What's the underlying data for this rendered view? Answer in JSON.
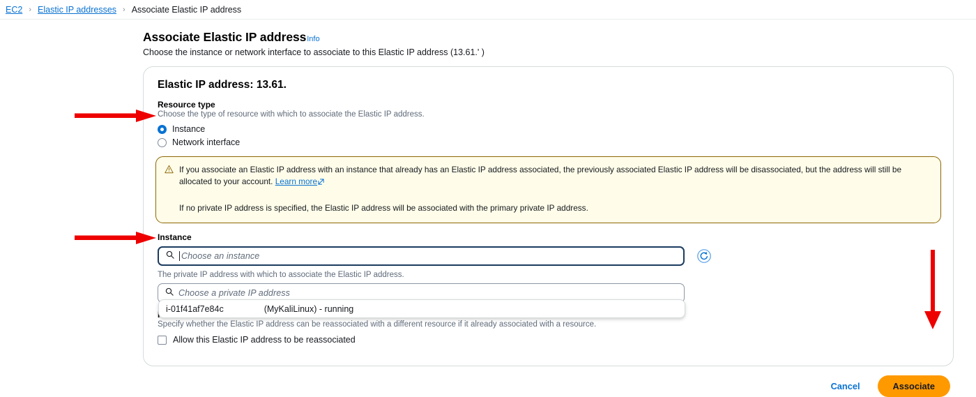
{
  "breadcrumb": {
    "items": [
      {
        "label": "EC2",
        "link": true
      },
      {
        "label": "Elastic IP addresses",
        "link": true
      },
      {
        "label": "Associate Elastic IP address",
        "link": false
      }
    ],
    "separator": "›"
  },
  "page": {
    "title": "Associate Elastic IP address",
    "info_label": "Info",
    "description": "Choose the instance or network interface to associate to this Elastic IP address (13.61.'             )"
  },
  "card": {
    "title": "Elastic IP address: 13.61.",
    "resource_type": {
      "label": "Resource type",
      "hint": "Choose the type of resource with which to associate the Elastic IP address.",
      "options": [
        {
          "label": "Instance",
          "selected": true
        },
        {
          "label": "Network interface",
          "selected": false
        }
      ]
    },
    "alert": {
      "icon": "warning-triangle-icon",
      "paragraph1": "If you associate an Elastic IP address with an instance that already has an Elastic IP address associated, the previously associated Elastic IP address will be disassociated, but the address will still be allocated to your account.",
      "link_text": "Learn more",
      "paragraph2": "If no private IP address is specified, the Elastic IP address will be associated with the primary private IP address.",
      "border_color": "#8d6605",
      "background_color": "#fffde9"
    },
    "instance": {
      "label": "Instance",
      "placeholder": "Choose an instance",
      "value": "",
      "refresh_icon": "refresh-icon",
      "dropdown_options": [
        {
          "id": "i-01f41af7e84c",
          "name_status": "(MyKaliLinux) - running"
        }
      ]
    },
    "private_ip": {
      "hint": "The private IP address with which to associate the Elastic IP address.",
      "placeholder": "Choose a private IP address",
      "value": ""
    },
    "reassociation": {
      "label": "Reassociation",
      "hint": "Specify whether the Elastic IP address can be reassociated with a different resource if it already associated with a resource.",
      "checkbox_label": "Allow this Elastic IP address to be reassociated",
      "checked": false
    }
  },
  "footer": {
    "cancel_label": "Cancel",
    "associate_label": "Associate",
    "associate_color": "#ff9900"
  },
  "annotations": {
    "color": "#ee0000",
    "arrows": [
      {
        "name": "arrow-to-instance-radio",
        "direction": "right"
      },
      {
        "name": "arrow-to-instance-dropdown-option",
        "direction": "right"
      },
      {
        "name": "arrow-to-associate-button",
        "direction": "down"
      }
    ]
  }
}
